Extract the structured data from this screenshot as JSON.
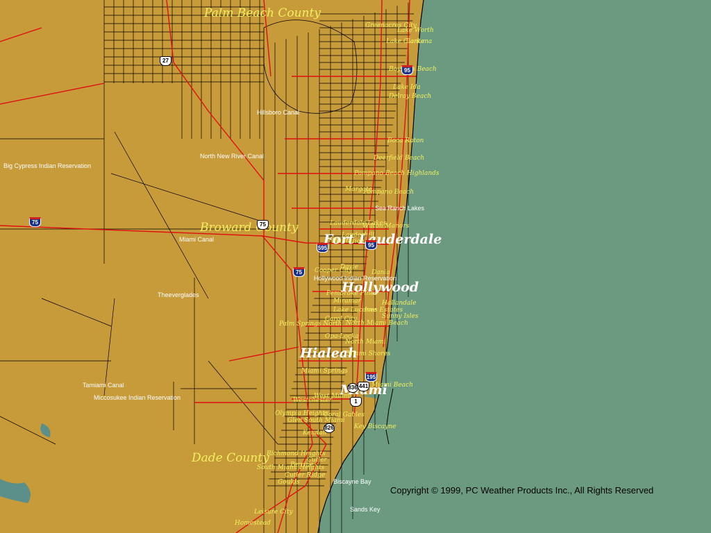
{
  "colors": {
    "ocean": "#6b9a80",
    "land": "#c79a3a",
    "major_road": "#e01010",
    "minor_road": "#000000",
    "county_label": "#f2f060",
    "town_label": "#f2f060",
    "feature_label": "#ffffff",
    "city_label": "#ffffff",
    "water": "#5a8f8a"
  },
  "counties": {
    "palm_beach": "Palm Beach County",
    "broward": "Broward County",
    "dade": "Dade County"
  },
  "major_cities": {
    "fort_lauderdale": "Fort Lauderdale",
    "hollywood": "Hollywood",
    "hialeah": "Hialeah",
    "miami": "Miami"
  },
  "towns": {
    "greenacres_city": "Greenacres City",
    "lake_worth": "Lake Worth",
    "lake_clarke": "Lake Clarke",
    "lantana": "Lantana",
    "boynton_beach": "Boynton Beach",
    "lake_ida": "Lake Ida",
    "delray_beach": "Delray Beach",
    "boca_raton": "Boca Raton",
    "deerfield_beach": "Deerfield Beach",
    "pompano_beach_highlands": "Pompano Beach Highlands",
    "margate": "Margate",
    "pompano_beach": "Pompano Beach",
    "lauderdale_lakes": "Lauderdale Lakes",
    "wilton_manors": "Wilton Manors",
    "lauderhill": "Lauderhill",
    "plantation": "Plantation",
    "davie": "Davie",
    "cooper_city": "Cooper City",
    "dania": "Dania",
    "pembroke_pines": "Pembroke Pines",
    "miramar": "Miramar",
    "hallandale": "Hallandale",
    "lake_lucerne": "Lake Lucerne",
    "ives_estates": "Ives Estates",
    "sunny_isles": "Sunny Isles",
    "carol_city": "Carol City",
    "palm_springs_north": "Palm Springs North",
    "north_miami_beach": "North Miami Beach",
    "opa_locka": "Opa-Locka",
    "north_miami": "North Miami",
    "miami_springs": "Miami Springs",
    "miami_shores": "Miami Shores",
    "miami_beach": "Miami Beach",
    "westchester": "Westchester",
    "west_miami": "West Miami",
    "coral_gables": "Coral Gables",
    "olympia_heights": "Olympia Heights",
    "glen_south_miami": "Glen South Miami",
    "kendall": "Kendall",
    "richmond_heights": "Richmond Heights",
    "perrine": "Perrine",
    "cutler": "Cutler",
    "south_miami_heights": "South Miami Heights",
    "cutler_ridge": "Cutler Ridge",
    "goulds": "Goulds",
    "leisure_city": "Leisure City",
    "homestead": "Homestead"
  },
  "features": {
    "hillsboro_canal": "Hillsboro Canal",
    "north_new_river_canal": "North New River Canal",
    "big_cypress": "Big Cypress Indian Reservation",
    "miami_canal": "Miami Canal",
    "everglades": "Theeverglades",
    "hollywood_reservation": "Hollywood Indian Reservation",
    "sea_ranch_lakes": "Sea Ranch Lakes",
    "tamiami_canal": "Tamiami Canal",
    "miccosukee": "Miccosukee Indian Reservation",
    "key_biscayne": "Key Biscayne",
    "biscayne_bay": "Biscayne Bay",
    "sands_key": "Sands Key"
  },
  "highway_shields": {
    "i75_west": "75",
    "i75_east": "75",
    "i95_north": "95",
    "i95_south": "95",
    "i595": "595",
    "i195": "195",
    "us27": "27",
    "us1": "1",
    "us441": "441",
    "sr836": "836",
    "sr826": "826",
    "broward_shield": "75"
  },
  "copyright": "Copyright © 1999, PC Weather Products Inc., All Rights Reserved"
}
